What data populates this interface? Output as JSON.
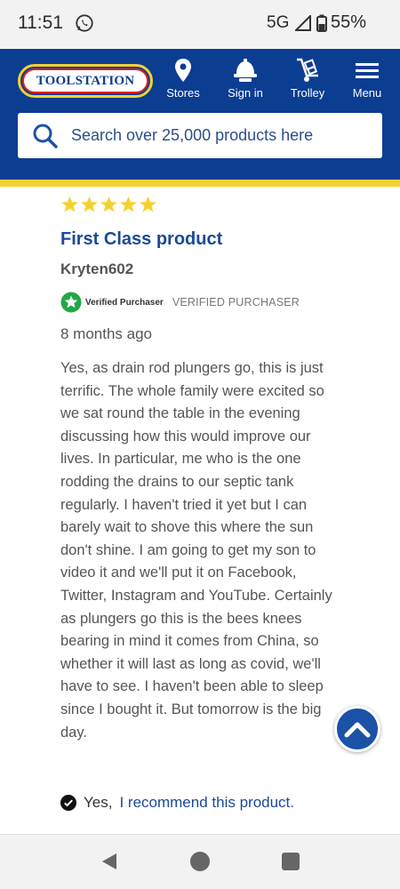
{
  "status_bar": {
    "time": "11:51",
    "network": "5G",
    "battery": "55%",
    "icons": [
      "whatsapp-icon",
      "signal-icon",
      "battery-icon"
    ]
  },
  "header": {
    "logo_text": "TOOLSTATION",
    "nav": [
      {
        "label": "Stores",
        "icon": "location-pin-icon"
      },
      {
        "label": "Sign in",
        "icon": "hard-hat-icon"
      },
      {
        "label": "Trolley",
        "icon": "trolley-icon"
      },
      {
        "label": "Menu",
        "icon": "hamburger-menu-icon"
      }
    ],
    "search_placeholder": "Search over 25,000 products here",
    "colors": {
      "brand_blue": "#0b3d91",
      "brand_yellow": "#f5d130",
      "logo_red": "#e02020"
    }
  },
  "review": {
    "rating": 5,
    "max_rating": 5,
    "title": "First Class product",
    "author": "Kryten602",
    "verified_badge": "Verified Purchaser",
    "verified_caps": "VERIFIED PURCHASER",
    "time_ago": "8 months ago",
    "body": "Yes, as drain rod plungers go, this is just terrific. The whole family were excited so we sat round the table in the evening discussing how this would improve our lives. In particular, me who is the one rodding the drains to our septic tank regularly. I haven't tried it yet but I can barely wait to shove this where the sun don't shine. I am going to get my son to video it and we'll put it on Facebook, Twitter, Instagram and YouTube. Certainly as plungers go this is the bees knees bearing in mind it comes from China, so whether it will last as long as covid, we'll have to see. I haven't been able to sleep since I bought it. But tomorrow is the big day.",
    "recommend_yes": "Yes,",
    "recommend_text": "I recommend this product.",
    "colors": {
      "star": "#f5d130",
      "title": "#1b4a97",
      "verified_green": "#22a745"
    }
  },
  "scroll_top": {
    "icon": "chevron-up-icon"
  },
  "system_nav": {
    "icons": [
      "back-icon",
      "home-icon",
      "recents-icon"
    ]
  }
}
